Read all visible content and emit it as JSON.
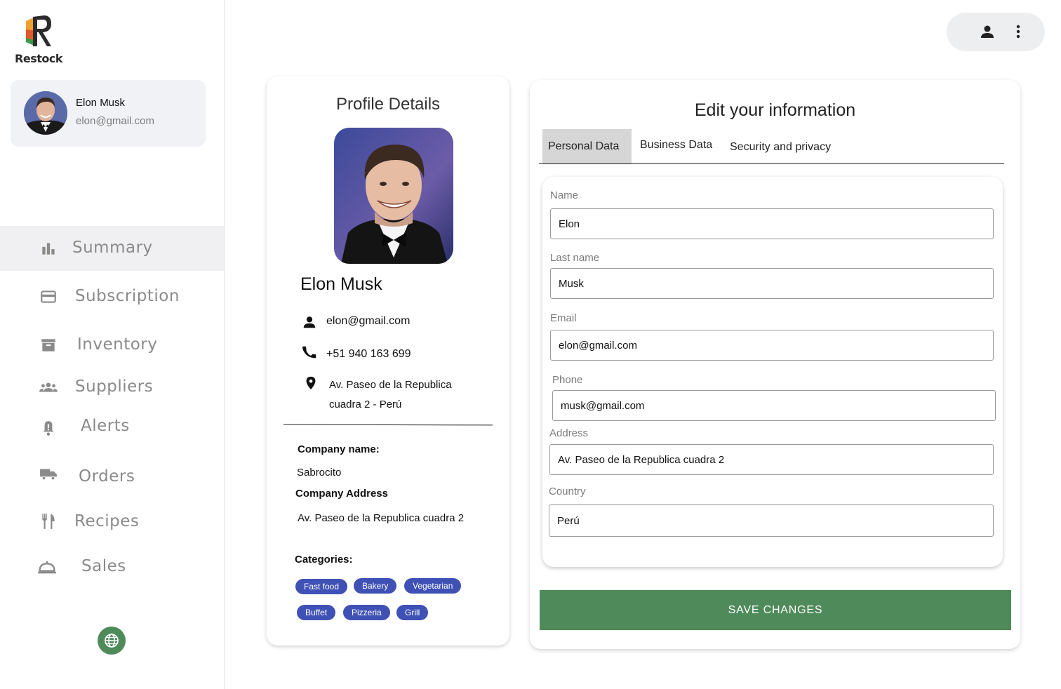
{
  "app": {
    "name": "Restock"
  },
  "user": {
    "name": "Elon Musk",
    "email": "elon@gmail.com"
  },
  "nav": {
    "items": [
      {
        "label": "Summary",
        "icon": "bar-chart-icon",
        "active": true
      },
      {
        "label": "Subscription",
        "icon": "credit-card-icon"
      },
      {
        "label": "Inventory",
        "icon": "archive-box-icon"
      },
      {
        "label": "Suppliers",
        "icon": "group-icon"
      },
      {
        "label": "Alerts",
        "icon": "bell-alert-icon"
      },
      {
        "label": "Orders",
        "icon": "truck-icon"
      },
      {
        "label": "Recipes",
        "icon": "fork-knife-icon"
      },
      {
        "label": "Sales",
        "icon": "room-service-icon"
      }
    ]
  },
  "profile": {
    "title": "Profile Details",
    "name": "Elon Musk",
    "email": "elon@gmail.com",
    "phone": "+51 940 163 699",
    "address": "Av. Paseo de la Republica cuadra 2 - Perú",
    "company_name_label": "Company name:",
    "company_name": "Sabrocito",
    "company_address_label": "Company Address",
    "company_address": "Av. Paseo de la Republica cuadra 2",
    "categories_label": "Categories:",
    "categories": [
      "Fast food",
      "Bakery",
      "Vegetarian",
      "Buffet",
      "Pizzeria",
      "Grill"
    ]
  },
  "edit": {
    "title": "Edit your information",
    "tabs": [
      {
        "label": "Personal Data",
        "active": true
      },
      {
        "label": "Business Data"
      },
      {
        "label": "Security and privacy"
      }
    ],
    "fields": {
      "name": {
        "label": "Name",
        "value": "Elon"
      },
      "last_name": {
        "label": "Last name",
        "value": "Musk"
      },
      "email": {
        "label": "Email",
        "value": "elon@gmail.com"
      },
      "phone": {
        "label": "Phone",
        "value": "musk@gmail.com"
      },
      "address": {
        "label": "Address",
        "value": "Av. Paseo de la Republica cuadra 2"
      },
      "country": {
        "label": "Country",
        "value": "Perú"
      }
    },
    "save_label": "SAVE CHANGES"
  },
  "colors": {
    "accent_green": "#4f8a5a",
    "chip_blue": "#3f51b5",
    "nav_text": "#8a8a8a",
    "active_bg": "#f0f0f2"
  }
}
